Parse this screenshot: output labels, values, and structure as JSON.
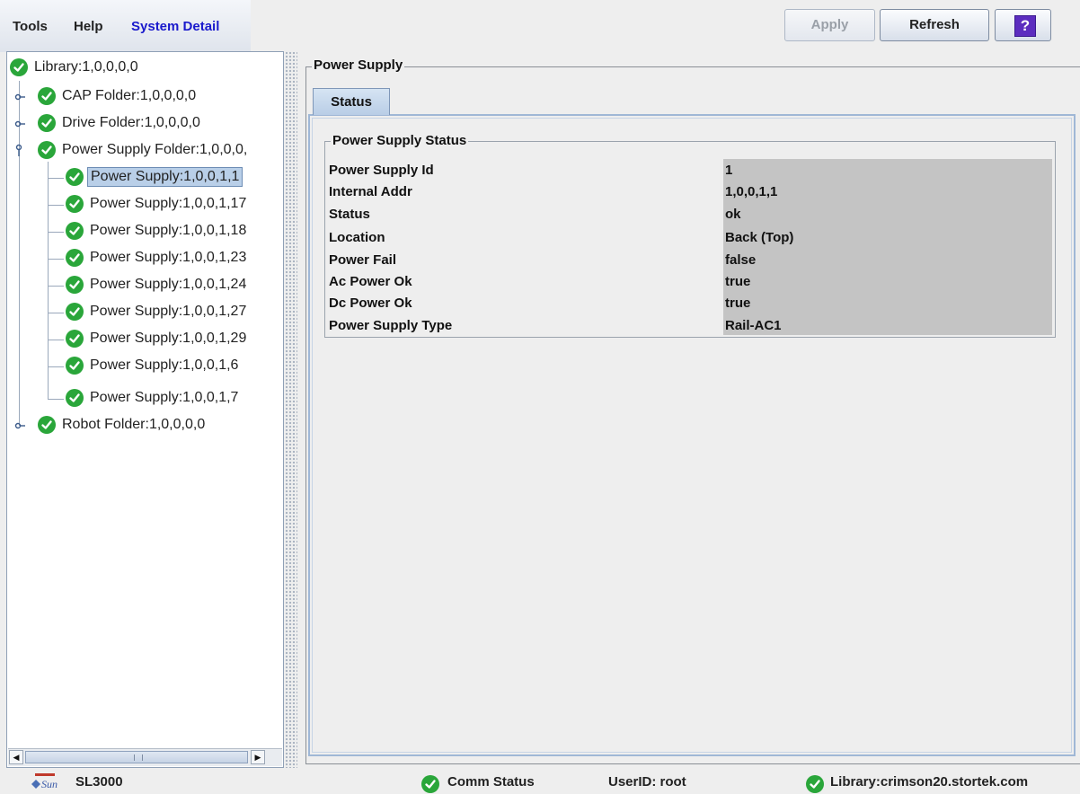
{
  "menubar": {
    "menus": [
      "Tools",
      "Help",
      "System Detail"
    ],
    "apply_label": "Apply",
    "refresh_label": "Refresh",
    "help_label": "?"
  },
  "tree": {
    "root": "Library:1,0,0,0,0",
    "cap_folder": "CAP Folder:1,0,0,0,0",
    "drive_folder": "Drive Folder:1,0,0,0,0",
    "power_folder": "Power Supply Folder:1,0,0,0,",
    "power_supplies": [
      "Power Supply:1,0,0,1,1",
      "Power Supply:1,0,0,1,17",
      "Power Supply:1,0,0,1,18",
      "Power Supply:1,0,0,1,23",
      "Power Supply:1,0,0,1,24",
      "Power Supply:1,0,0,1,27",
      "Power Supply:1,0,0,1,29",
      "Power Supply:1,0,0,1,6",
      "Power Supply:1,0,0,1,7"
    ],
    "robot_folder": "Robot Folder:1,0,0,0,0",
    "selected": "Power Supply:1,0,0,1,1"
  },
  "panel": {
    "title": "Power Supply",
    "tab": "Status",
    "group_title": "Power Supply Status",
    "rows": [
      {
        "label": "Power Supply Id",
        "value": "1"
      },
      {
        "label": "Internal Addr",
        "value": "1,0,0,1,1"
      },
      {
        "label": "Status",
        "value": "ok"
      },
      {
        "label": "Location",
        "value": "Back (Top)"
      },
      {
        "label": "Power Fail",
        "value": "false"
      },
      {
        "label": "Ac Power Ok",
        "value": "true"
      },
      {
        "label": "Dc Power Ok",
        "value": "true"
      },
      {
        "label": "Power Supply Type",
        "value": "Rail-AC1"
      }
    ]
  },
  "statusbar": {
    "product": "SL3000",
    "logo_text": "Sun",
    "comm_status": "Comm Status",
    "user": "UserID: root",
    "library": "Library:crimson20.stortek.com"
  },
  "colors": {
    "ok_green": "#2aa63a",
    "selection": "#b9cfe8",
    "active_menu": "#1a1acc",
    "help_purple": "#5c2dbf"
  }
}
